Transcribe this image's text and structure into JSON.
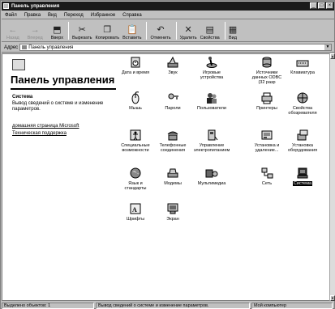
{
  "window": {
    "title": "Панель управления",
    "controls": [
      "_",
      "□",
      "×"
    ]
  },
  "menu": [
    "Файл",
    "Правка",
    "Вид",
    "Переход",
    "Избранное",
    "Справка"
  ],
  "toolbar": {
    "back": "Назад",
    "forward": "Вперед",
    "up": "Вверх",
    "cut": "Вырезать",
    "copy": "Копировать",
    "paste": "Вставить",
    "undo": "Отменить",
    "delete": "Удалить",
    "properties": "Свойства",
    "views": "Вид"
  },
  "address": {
    "label": "Адрес",
    "value": "Панель управления"
  },
  "left_pane": {
    "title": "Панель управления",
    "selected_name": "Система",
    "selected_description": "Вывод сведений о системе и изменение параметров.",
    "links": [
      "домашняя страница Microsoft",
      "Техническая поддержка"
    ]
  },
  "icons": [
    {
      "label": "Дата и время",
      "icon": "datetime-icon"
    },
    {
      "label": "Звук",
      "icon": "sound-icon"
    },
    {
      "label": "Игровые устройства",
      "icon": "joystick-icon"
    },
    {
      "label": "Источники данных ODBC (32 разр",
      "icon": "odbc-icon"
    },
    {
      "label": "Клавиатура",
      "icon": "keyboard-icon"
    },
    {
      "label": "Мышь",
      "icon": "mouse-icon"
    },
    {
      "label": "Пароли",
      "icon": "passwords-icon"
    },
    {
      "label": "Пользователи",
      "icon": "users-icon"
    },
    {
      "label": "Принтеры",
      "icon": "printers-icon"
    },
    {
      "label": "Свойства обозревателя",
      "icon": "internet-options-icon"
    },
    {
      "label": "Специальные возможности",
      "icon": "accessibility-icon"
    },
    {
      "label": "Телефонные соединения",
      "icon": "telephony-icon"
    },
    {
      "label": "Управление электропитанием",
      "icon": "power-icon"
    },
    {
      "label": "Установка и удаление...",
      "icon": "add-remove-icon"
    },
    {
      "label": "Установка оборудования",
      "icon": "add-hardware-icon"
    },
    {
      "label": "Язык и стандарты",
      "icon": "regional-icon"
    },
    {
      "label": "Модемы",
      "icon": "modem-icon"
    },
    {
      "label": "Мультимедиа",
      "icon": "multimedia-icon"
    },
    {
      "label": "Сеть",
      "icon": "network-icon"
    },
    {
      "label": "Система",
      "icon": "system-icon"
    },
    {
      "label": "Шрифты",
      "icon": "fonts-icon"
    },
    {
      "label": "Экран",
      "icon": "display-icon"
    }
  ],
  "status": {
    "count": "Выделено объектов: 1",
    "hint": "Вывод сведений о системе и изменение параметров.",
    "zone": "Мой компьютер"
  }
}
